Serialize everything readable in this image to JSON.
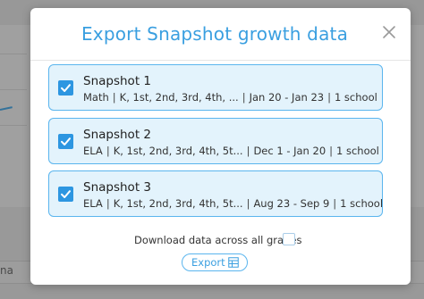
{
  "background": {
    "partial_text": "na"
  },
  "modal": {
    "title": "Export Snapshot growth data",
    "snapshots": [
      {
        "name": "Snapshot 1",
        "checked": true,
        "subject": "Math",
        "grades": "K, 1st, 2nd, 3rd, 4th, ...",
        "dates": "Jan 20 - Jan 23",
        "schools": "1 school"
      },
      {
        "name": "Snapshot 2",
        "checked": true,
        "subject": "ELA",
        "grades": "K, 1st, 2nd, 3rd, 4th, 5t...",
        "dates": "Dec 1 - Jan 20",
        "schools": "1 school"
      },
      {
        "name": "Snapshot 3",
        "checked": true,
        "subject": "ELA",
        "grades": "K, 1st, 2nd, 3rd, 4th, 5t...",
        "dates": "Aug 23 - Sep 9",
        "schools": "1 school"
      }
    ],
    "all_grades": {
      "label": "Download data across all grades",
      "checked": false
    },
    "export_label": "Export",
    "icons": {
      "close": "close-icon",
      "check": "checkmark-icon",
      "export": "spreadsheet-icon"
    },
    "colors": {
      "accent": "#3a9fe0",
      "card_bg": "#e3f3fc",
      "card_border": "#5ab5ee",
      "checkbox": "#2d96e1"
    }
  }
}
